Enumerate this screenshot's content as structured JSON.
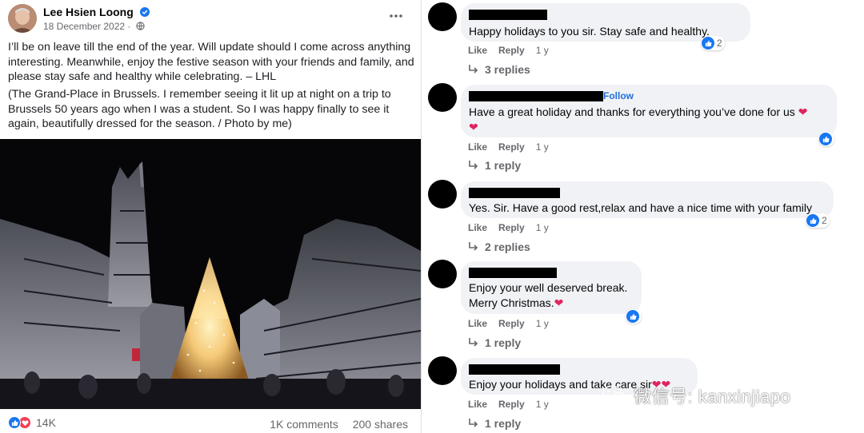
{
  "post": {
    "author": "Lee Hsien Loong",
    "date": "18 December 2022",
    "paragraph1": "I’ll be on leave till the end of the year. Will update should I come across anything interesting. Meanwhile, enjoy the festive season with your friends and family, and please stay safe and healthy while celebrating. – LHL",
    "paragraph2": "(The Grand-Place in Brussels. I remember seeing it lit up at night on a trip to Brussels 50 years ago when I was a student. So I was happy finally to see it again, beautifully dressed for the season. / Photo by me)",
    "reaction_count": "14K",
    "comments_count": "1K comments",
    "shares_count": "200 shares"
  },
  "comments": [
    {
      "text": "Happy holidays to you sir. Stay safe and healthy.",
      "reaction_count": "2",
      "like": "Like",
      "reply": "Reply",
      "time": "1 y",
      "replies": "3 replies"
    },
    {
      "follow": "Follow",
      "text": "Have a great holiday and thanks for everything you’ve done for us",
      "like": "Like",
      "reply": "Reply",
      "time": "1 y",
      "replies": "1 reply"
    },
    {
      "text": "Yes. Sir. Have a good rest,relax and have a nice time with your family",
      "reaction_count": "2",
      "like": "Like",
      "reply": "Reply",
      "time": "1 y",
      "replies": "2 replies"
    },
    {
      "text_line1": "Enjoy your well deserved break.",
      "text_line2": "Merry Christmas.",
      "like": "Like",
      "reply": "Reply",
      "time": "1 y",
      "replies": "1 reply"
    },
    {
      "text": "Enjoy your holidays and take care sir",
      "like": "Like",
      "reply": "Reply",
      "time": "1 y",
      "replies": "1 reply"
    }
  ],
  "watermark": {
    "text": "微信号: kanxinjiapo"
  },
  "colors": {
    "facebook_blue": "#1877f2",
    "love_red": "#f33e58",
    "bubble_grey": "#f0f2f5",
    "meta_grey": "#65676b"
  },
  "icons": [
    "verified-badge-icon",
    "globe-icon",
    "more-options-icon",
    "like-reaction-icon",
    "love-reaction-icon",
    "reply-arrow-icon",
    "heart-emoji-icon",
    "wechat-icon"
  ]
}
